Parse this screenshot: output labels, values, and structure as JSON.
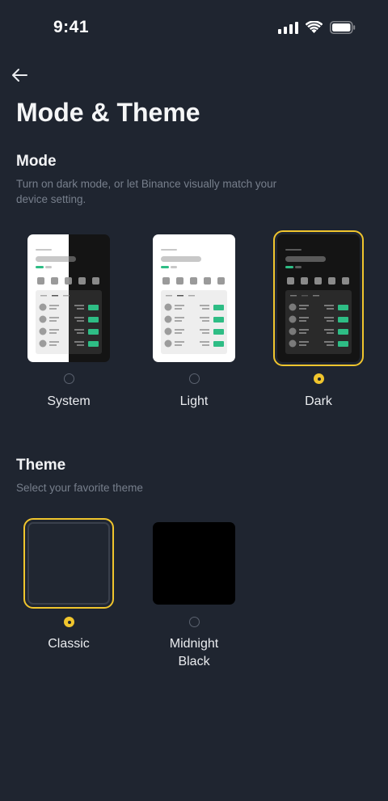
{
  "status": {
    "time": "9:41"
  },
  "header": {
    "title": "Mode & Theme"
  },
  "mode": {
    "title": "Mode",
    "description_line1": "Turn on dark mode, or let Binance visually match your",
    "description_line2": "device setting.",
    "options": [
      {
        "label": "System",
        "selected": false
      },
      {
        "label": "Light",
        "selected": false
      },
      {
        "label": "Dark",
        "selected": true
      }
    ]
  },
  "theme": {
    "title": "Theme",
    "description": "Select your favorite theme",
    "options": [
      {
        "label": "Classic",
        "selected": true
      },
      {
        "label_line1": "Midnight",
        "label_line2": "Black",
        "selected": false
      }
    ]
  },
  "colors": {
    "background": "#1f2530",
    "accent": "#f0c52d",
    "green": "#2ebd85"
  }
}
